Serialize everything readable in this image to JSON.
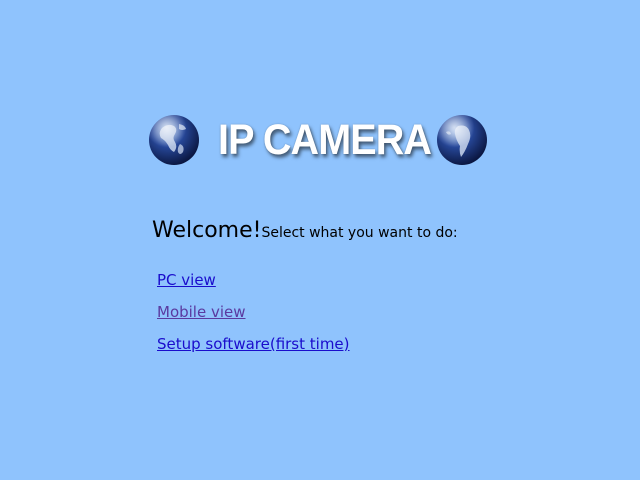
{
  "header": {
    "title": "IP CAMERA",
    "left_icon": "globe-americas-icon",
    "right_icon": "globe-south-america-icon"
  },
  "welcome": {
    "greeting": "Welcome!",
    "prompt": "Select what you want to do:"
  },
  "links": [
    {
      "label": "PC view",
      "state": "unvisited"
    },
    {
      "label": "Mobile view",
      "state": "visited"
    },
    {
      "label": "Setup software(first time)",
      "state": "unvisited"
    }
  ],
  "colors": {
    "background": "#8fc3fd",
    "link": "#1a0dcc",
    "visited_link": "#5a3aa0",
    "title_text": "#ffffff"
  }
}
